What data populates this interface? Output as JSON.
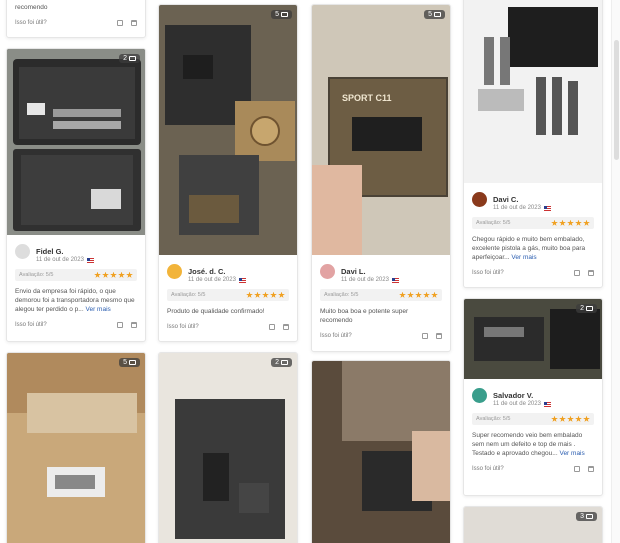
{
  "colors": {
    "star": "#f0a020",
    "link": "#2a5db0"
  },
  "cards": [
    {
      "id": "top-left",
      "helpful": "Isso foi útil?",
      "text": "recomendo"
    },
    {
      "id": "fidel",
      "photos": "2",
      "name": "Fidel G.",
      "date": "11 de out de 2023",
      "rating": "Avaliação: 5/5",
      "text": "Envio da empresa foi rápido, o que demorou foi a transportadora mesmo que alegou ter perdido o p...",
      "more": "Ver mais",
      "helpful": "Isso foi útil?"
    },
    {
      "id": "jose",
      "photos": "5",
      "name": "José. d. C.",
      "date": "11 de out de 2023",
      "rating": "Avaliação: 5/5",
      "text": "Produto de qualidade confirmado!",
      "helpful": "Isso foi útil?"
    },
    {
      "id": "davi-l",
      "photos": "5",
      "name": "Davi L.",
      "date": "11 de out de 2023",
      "rating": "Avaliação: 5/5",
      "text": "Muito boa boa e potente super recomendo",
      "helpful": "Isso foi útil?",
      "image_text": "SPORT C11"
    },
    {
      "id": "davi-c",
      "name": "Davi C.",
      "date": "11 de out de 2023",
      "rating": "Avaliação: 5/5",
      "text": "Chegou rápido e muito bem embalado, excelente pistola a gás, muito boa para aperfeiçoar...",
      "more": "Ver mais",
      "helpful": "Isso foi útil?"
    },
    {
      "id": "salvador",
      "photos": "2",
      "name": "Salvador V.",
      "date": "11 de out de 2023",
      "rating": "Avaliação: 5/5",
      "text": "Super recomendo veio bem embalado sem nem um defeito e top de mais . Testado e aprovado chegou...",
      "more": "Ver mais",
      "helpful": "Isso foi útil?"
    },
    {
      "id": "box",
      "photos": "5"
    },
    {
      "id": "case",
      "photos": "2"
    },
    {
      "id": "shoot"
    },
    {
      "id": "last",
      "photos": "3"
    }
  ]
}
